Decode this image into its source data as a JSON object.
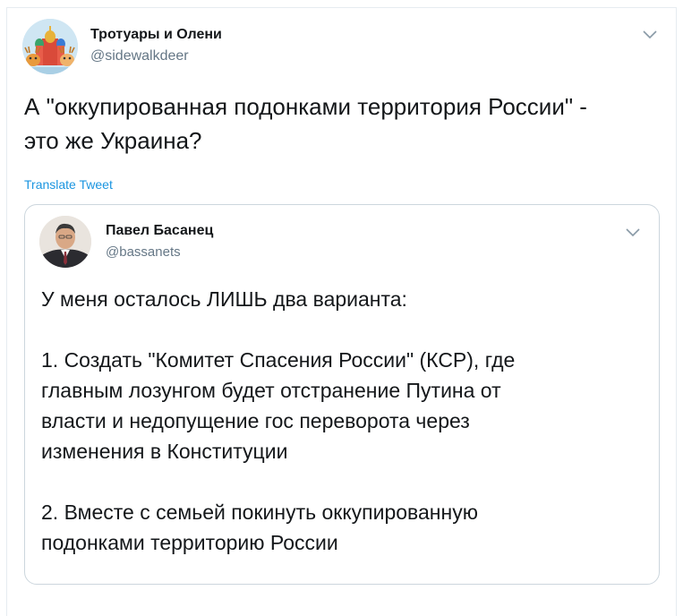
{
  "tweet": {
    "author_name": "Тротуары и Олени",
    "author_handle": "@sidewalkdeer",
    "text_line1": "А \"оккупированная подонками территория России\" -",
    "text_line2": "это же Украина?",
    "translate_label": "Translate Tweet"
  },
  "quoted_tweet": {
    "author_name": "Павел Басанец",
    "author_handle": "@bassanets",
    "paragraph1": "У меня осталось ЛИШЬ два варианта:",
    "point1_line1": "1. Создать \"Комитет Спасения России\" (КСР), где",
    "point1_line2": "главным лозунгом будет отстранение Путина от",
    "point1_line3": "власти и недопущение гос переворота через",
    "point1_line4": "изменения в Конституции",
    "point2_line1": "2. Вместе с семьей покинуть оккупированную",
    "point2_line2": "подонками территорию России"
  },
  "colors": {
    "link": "#1b95e0",
    "secondary_text": "#657786",
    "border": "#ccd6dd"
  },
  "icons": [
    "chevron-down-icon",
    "avatar"
  ]
}
